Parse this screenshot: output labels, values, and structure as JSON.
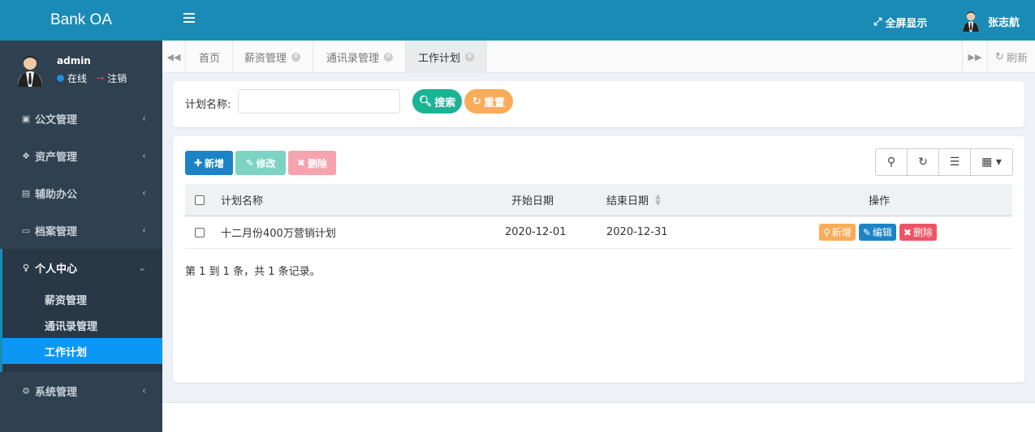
{
  "brand": "Bank OA",
  "user": {
    "name": "admin",
    "status": "在线",
    "logout": "注销"
  },
  "menu": [
    {
      "label": "公文管理",
      "icon": "briefcase-icon"
    },
    {
      "label": "资产管理",
      "icon": "cubes-icon"
    },
    {
      "label": "辅助办公",
      "icon": "file-icon"
    },
    {
      "label": "档案管理",
      "icon": "inbox-icon"
    },
    {
      "label": "个人中心",
      "icon": "person-icon"
    },
    {
      "label": "系统管理",
      "icon": "gear-icon"
    }
  ],
  "submenu": [
    "薪资管理",
    "通讯录管理",
    "工作计划"
  ],
  "topbar": {
    "fullscreen": "全屏显示",
    "username": "张志航"
  },
  "tabs": [
    {
      "label": "首页"
    },
    {
      "label": "薪资管理"
    },
    {
      "label": "通讯录管理"
    },
    {
      "label": "工作计划"
    }
  ],
  "refresh": "刷新",
  "search": {
    "label": "计划名称:",
    "value": "",
    "search_btn": "搜索",
    "reset_btn": "重置"
  },
  "toolbar": {
    "add": "新增",
    "edit": "修改",
    "delete": "删除"
  },
  "table": {
    "headers": {
      "name": "计划名称",
      "start": "开始日期",
      "end": "结束日期",
      "ops": "操作"
    },
    "rows": [
      {
        "name": "十二月份400万营销计划",
        "start": "2020-12-01",
        "end": "2020-12-31",
        "op_add": "新增",
        "op_edit": "编辑",
        "op_delete": "删除"
      }
    ]
  },
  "pager": "第 1 到 1 条，共 1 条记录。",
  "colors": {
    "primary": "#1a8bb6",
    "sidebar": "#2f4050",
    "green": "#1ab394",
    "orange": "#f8ac59",
    "red": "#ed5565",
    "blue": "#1c84c6",
    "active_sub": "#0d97f5"
  }
}
